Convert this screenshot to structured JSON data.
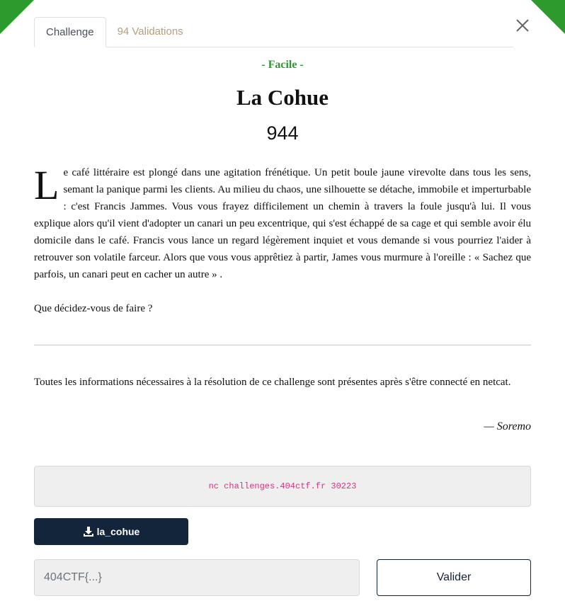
{
  "colors": {
    "accent": "#2d9a2d",
    "dark": "#12253a",
    "code": "#d63384",
    "tab_inactive": "#b59e7e"
  },
  "tabs": [
    {
      "label": "Challenge",
      "active": true
    },
    {
      "label": "94 Validations",
      "active": false
    }
  ],
  "close_icon": "close-icon",
  "challenge": {
    "difficulty": "- Facile -",
    "title": "La Cohue",
    "points": "944",
    "description_dropcap": "L",
    "description_rest": "e café littéraire est plongé dans une agitation frénétique. Un petit boule jaune virevolte dans tous les sens, semant la panique parmi les clients. Au milieu du chaos, une silhouette se détache, immobile et imperturbable : c'est Francis Jammes. Vous vous frayez difficilement un chemin à travers la foule jusqu'à lui. Il vous explique alors qu'il vient d'adopter un canari un peu excentrique, qui s'est échappé de sa cage et qui semble avoir élu domicile dans le café. Francis vous lance un regard légèrement inquiet et vous demande si vous pourriez l'aider à retrouver son volatile farceur. Alors que vous vous apprêtiez à partir, James vous murmure à l'oreille : « Sachez que parfois, un canari peut en cacher un autre » .",
    "question": "Que décidez-vous de faire ?",
    "info": "Toutes les informations nécessaires à la résolution de ce challenge sont présentes après s'être connecté en netcat.",
    "author": "— Soremo"
  },
  "connection": {
    "command": "nc challenges.404ctf.fr 30223"
  },
  "download": {
    "label": "la_cohue",
    "icon": "download-icon"
  },
  "flag": {
    "placeholder": "404CTF{...}",
    "value": ""
  },
  "submit": {
    "label": "Valider"
  }
}
